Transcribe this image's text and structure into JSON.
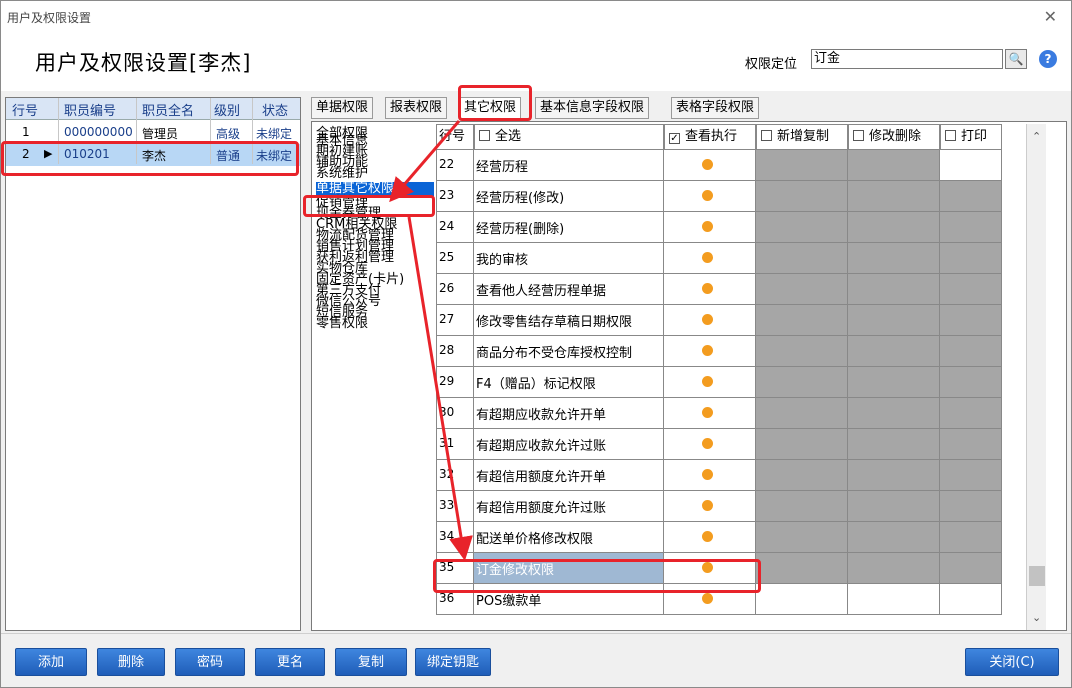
{
  "window": {
    "title": "用户及权限设置",
    "close_glyph": "✕"
  },
  "header": {
    "title": "用户及权限设置[李杰]",
    "locate_label": "权限定位",
    "locate_value": "订金",
    "locate_button": "🔍",
    "help_glyph": "?"
  },
  "employee_grid": {
    "columns": [
      "行号",
      "职员编号",
      "职员全名",
      "级别",
      "状态"
    ],
    "rows": [
      {
        "no": "1",
        "code": "000000000",
        "name": "管理员",
        "level": "高级",
        "status": "未绑定"
      },
      {
        "no": "2",
        "code": "010201",
        "name": "李杰",
        "level": "普通",
        "status": "未绑定"
      }
    ],
    "current_marker": "▶"
  },
  "tabs": [
    "单据权限",
    "报表权限",
    "其它权限",
    "基本信息字段权限",
    "表格字段权限"
  ],
  "active_tab": "其它权限",
  "categories": [
    "全部权限",
    "基本信息",
    "期初建账",
    "辅助功能",
    "系统维护",
    "单据其它权限",
    "促销管理",
    "现金券管理",
    "CRM相关权限",
    "物流配货管理",
    "销售计划管理",
    "获利返利管理",
    "实物仓库",
    "固定资产(卡片)",
    "第三方支付",
    "微信公众号",
    "短信服务",
    "零售权限"
  ],
  "selected_category": "单据其它权限",
  "perm_grid": {
    "header": {
      "row_no": "行号",
      "select_all": "全选",
      "view_exec": "查看执行",
      "add_copy": "新增复制",
      "modify_delete": "修改删除",
      "print": "打印",
      "view_checked_mark": "✓"
    },
    "rows": [
      {
        "no": "22",
        "name": "经营历程"
      },
      {
        "no": "23",
        "name": "经营历程(修改)"
      },
      {
        "no": "24",
        "name": "经营历程(删除)"
      },
      {
        "no": "25",
        "name": "我的审核"
      },
      {
        "no": "26",
        "name": "查看他人经营历程单据"
      },
      {
        "no": "27",
        "name": "修改零售结存草稿日期权限"
      },
      {
        "no": "28",
        "name": "商品分布不受仓库授权控制"
      },
      {
        "no": "29",
        "name": "F4（赠品）标记权限"
      },
      {
        "no": "30",
        "name": "有超期应收款允许开单"
      },
      {
        "no": "31",
        "name": "有超期应收款允许过账"
      },
      {
        "no": "32",
        "name": "有超信用额度允许开单"
      },
      {
        "no": "33",
        "name": "有超信用额度允许过账"
      },
      {
        "no": "34",
        "name": "配送单价格修改权限"
      },
      {
        "no": "35",
        "name": "订金修改权限"
      },
      {
        "no": "36",
        "name": "POS缴款单"
      }
    ]
  },
  "buttons": {
    "add": "添加",
    "delete": "删除",
    "password": "密码",
    "rename": "更名",
    "copy": "复制",
    "bind_key": "绑定钥匙",
    "close": "关闭(C)"
  },
  "colors": {
    "annotation": "#e8232a",
    "dot": "#f39c1f",
    "button": "#2a6fcf",
    "selected": "#0a64d6"
  }
}
